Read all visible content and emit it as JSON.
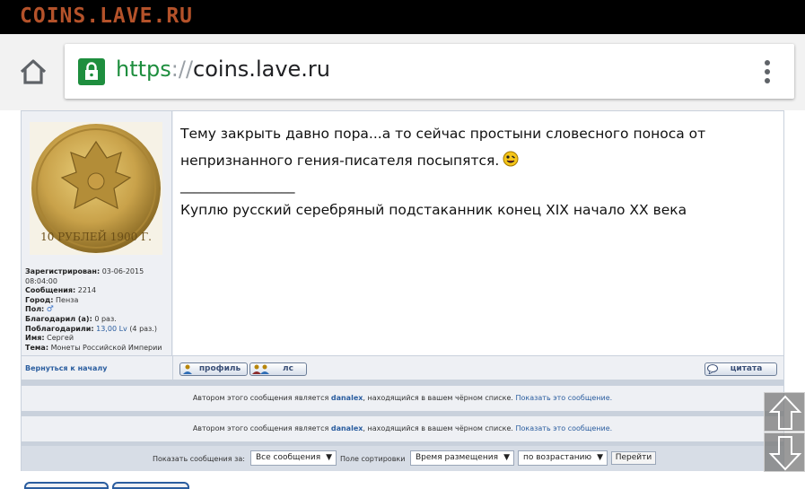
{
  "site": {
    "logo": "COINS.LAVE.RU"
  },
  "browser": {
    "url_scheme": "https",
    "url_sep": "://",
    "url_host": "coins.lave.ru",
    "icons": [
      "home-icon",
      "lock-icon",
      "more-vert-icon"
    ]
  },
  "post": {
    "author": {
      "registered_label": "Зарегистрирован:",
      "registered_value": "03-06-2015 08:04:00",
      "messages_label": "Сообщения:",
      "messages_value": "2214",
      "city_label": "Город:",
      "city_value": "Пенза",
      "gender_label": "Пол:",
      "thanked_label": "Благодарил (а):",
      "thanked_value": "0 раз.",
      "thanks_received_label": "Поблагодарили:",
      "thanks_received_lv": "13,00 Lv",
      "thanks_received_count": "(4 раз.)",
      "name_label": "Имя:",
      "name_value": "Сергей",
      "topic_label": "Тема:",
      "topic_value": "Монеты Российской Империи",
      "avatar_coin_text": "10 РУБЛЕЙ 1900 Г."
    },
    "message_text": "Тему закрыть давно пора...а то сейчас простыни словесного поноса от непризнанного гения-писателя посыпятся.",
    "signature_separator": "_________________",
    "signature": "Куплю русский серебряный подстаканник конец XIX начало XX века"
  },
  "actions": {
    "back_to_top": "Вернуться к началу",
    "profile_label": "профиль",
    "pm_label": "лс",
    "quote_label": "цитата"
  },
  "blocked": [
    {
      "prefix": "Автором этого сообщения является",
      "user": "danalex",
      "suffix": ", находящийся в вашем чёрном списке.",
      "show": "Показать это сообщение."
    },
    {
      "prefix": "Автором этого сообщения является",
      "user": "danalex",
      "suffix": ", находящийся в вашем чёрном списке.",
      "show": "Показать это сообщение."
    }
  ],
  "filters": {
    "show_label": "Показать сообщения за:",
    "period_value": "Все сообщения",
    "sort_label": "Поле сортировки",
    "sort_value": "Время размещения",
    "order_value": "по возрастанию",
    "go_label": "Перейти"
  },
  "scroll": {
    "up_icon": "arrow-up-icon",
    "down_icon": "arrow-down-icon"
  },
  "colors": {
    "link": "#2a5d9f",
    "brand": "#b4522a",
    "secure": "#1e8e3e"
  }
}
